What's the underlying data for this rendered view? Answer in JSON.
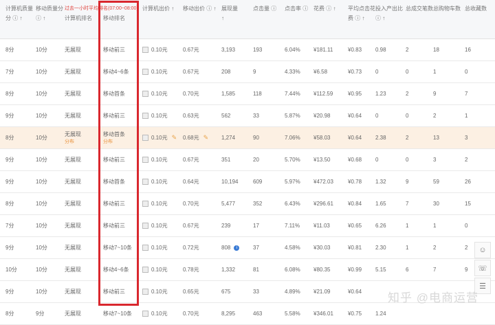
{
  "header": {
    "c0": [
      "计算机质量",
      "分 ⓘ ↑"
    ],
    "c1": [
      "移动质量分",
      "ⓘ ↑"
    ],
    "c2_note": "过去一小时平均排名(07:00~08:00)",
    "c2": "计算机排名",
    "c3": "移动排名",
    "c4": "计算机出价 ↑",
    "c5": "移动出价 ⓘ ↑",
    "c6": [
      "展现量",
      "↑"
    ],
    "c7": "点击量 ⓘ",
    "c8": "点击率 ⓘ",
    "c9": "花费 ⓘ ↑",
    "c10": [
      "平均点击花",
      "费 ⓘ ↑"
    ],
    "c11": [
      "投入产出比",
      "ⓘ ↑"
    ],
    "c12": "总成交笔数",
    "c13": "总购物车数",
    "c14": "总收藏数"
  },
  "rows": [
    {
      "pc_q": "8分",
      "m_q": "10分",
      "pc_rank": "无展现",
      "m_rank": "移动前三",
      "pc_bid": "0.10元",
      "m_bid": "0.67元",
      "imp": "3,193",
      "clk": "193",
      "ctr": "6.04%",
      "cost": "¥181.11",
      "cpc": "¥0.83",
      "roi": "0.98",
      "deals": "2",
      "cart": "18",
      "fav": "16"
    },
    {
      "pc_q": "7分",
      "m_q": "10分",
      "pc_rank": "无展现",
      "m_rank": "移动4~6条",
      "pc_bid": "0.10元",
      "m_bid": "0.67元",
      "imp": "208",
      "clk": "9",
      "ctr": "4.33%",
      "cost": "¥6.58",
      "cpc": "¥0.73",
      "roi": "0",
      "deals": "0",
      "cart": "1",
      "fav": "0"
    },
    {
      "pc_q": "8分",
      "m_q": "10分",
      "pc_rank": "无展现",
      "m_rank": "移动首条",
      "pc_bid": "0.10元",
      "m_bid": "0.70元",
      "imp": "1,585",
      "clk": "118",
      "ctr": "7.44%",
      "cost": "¥112.59",
      "cpc": "¥0.95",
      "roi": "1.23",
      "deals": "2",
      "cart": "9",
      "fav": "7"
    },
    {
      "pc_q": "9分",
      "m_q": "10分",
      "pc_rank": "无展现",
      "m_rank": "移动前三",
      "pc_bid": "0.10元",
      "m_bid": "0.63元",
      "imp": "562",
      "clk": "33",
      "ctr": "5.87%",
      "cost": "¥20.98",
      "cpc": "¥0.64",
      "roi": "0",
      "deals": "0",
      "cart": "2",
      "fav": "1"
    },
    {
      "pc_q": "8分",
      "m_q": "10分",
      "pc_rank": "无展现",
      "pc_sub": "分布",
      "m_rank": "移动首条",
      "m_sub": "分布",
      "pc_bid": "0.10元",
      "m_bid": "0.68元",
      "imp": "1,274",
      "clk": "90",
      "ctr": "7.06%",
      "cost": "¥58.03",
      "cpc": "¥0.64",
      "roi": "2.38",
      "deals": "2",
      "cart": "13",
      "fav": "3",
      "highlight": true,
      "edit": true
    },
    {
      "pc_q": "9分",
      "m_q": "10分",
      "pc_rank": "无展现",
      "m_rank": "移动前三",
      "pc_bid": "0.10元",
      "m_bid": "0.67元",
      "imp": "351",
      "clk": "20",
      "ctr": "5.70%",
      "cost": "¥13.50",
      "cpc": "¥0.68",
      "roi": "0",
      "deals": "0",
      "cart": "3",
      "fav": "2"
    },
    {
      "pc_q": "9分",
      "m_q": "10分",
      "pc_rank": "无展现",
      "m_rank": "移动首条",
      "pc_bid": "0.10元",
      "m_bid": "0.64元",
      "imp": "10,194",
      "clk": "609",
      "ctr": "5.97%",
      "cost": "¥472.03",
      "cpc": "¥0.78",
      "roi": "1.32",
      "deals": "9",
      "cart": "59",
      "fav": "26"
    },
    {
      "pc_q": "8分",
      "m_q": "10分",
      "pc_rank": "无展现",
      "m_rank": "移动前三",
      "pc_bid": "0.10元",
      "m_bid": "0.70元",
      "imp": "5,477",
      "clk": "352",
      "ctr": "6.43%",
      "cost": "¥296.61",
      "cpc": "¥0.84",
      "roi": "1.65",
      "deals": "7",
      "cart": "30",
      "fav": "15"
    },
    {
      "pc_q": "7分",
      "m_q": "10分",
      "pc_rank": "无展现",
      "m_rank": "移动前三",
      "pc_bid": "0.10元",
      "m_bid": "0.67元",
      "imp": "239",
      "clk": "17",
      "ctr": "7.11%",
      "cost": "¥11.03",
      "cpc": "¥0.65",
      "roi": "6.26",
      "deals": "1",
      "cart": "1",
      "fav": "0"
    },
    {
      "pc_q": "9分",
      "m_q": "10分",
      "pc_rank": "无展现",
      "m_rank": "移动7~10条",
      "pc_bid": "0.10元",
      "m_bid": "0.72元",
      "imp": "808",
      "clk": "37",
      "ctr": "4.58%",
      "cost": "¥30.03",
      "cpc": "¥0.81",
      "roi": "2.30",
      "deals": "1",
      "cart": "2",
      "fav": "2",
      "info": true
    },
    {
      "pc_q": "10分",
      "m_q": "10分",
      "pc_rank": "无展现",
      "m_rank": "移动4~6条",
      "pc_bid": "0.10元",
      "m_bid": "0.78元",
      "imp": "1,332",
      "clk": "81",
      "ctr": "6.08%",
      "cost": "¥80.35",
      "cpc": "¥0.99",
      "roi": "5.15",
      "deals": "6",
      "cart": "7",
      "fav": "9"
    },
    {
      "pc_q": "9分",
      "m_q": "10分",
      "pc_rank": "无展现",
      "m_rank": "移动前三",
      "pc_bid": "0.10元",
      "m_bid": "0.65元",
      "imp": "675",
      "clk": "33",
      "ctr": "4.89%",
      "cost": "¥21.09",
      "cpc": "¥0.64",
      "roi": "",
      "deals": "",
      "cart": "",
      "fav": ""
    },
    {
      "pc_q": "8分",
      "m_q": "9分",
      "pc_rank": "无展现",
      "m_rank": "移动7~10条",
      "pc_bid": "0.10元",
      "m_bid": "0.70元",
      "imp": "8,295",
      "clk": "463",
      "ctr": "5.58%",
      "cost": "¥346.01",
      "cpc": "¥0.75",
      "roi": "1.24",
      "deals": "",
      "cart": "",
      "fav": ""
    }
  ],
  "watermark": "知乎 @电商运营"
}
